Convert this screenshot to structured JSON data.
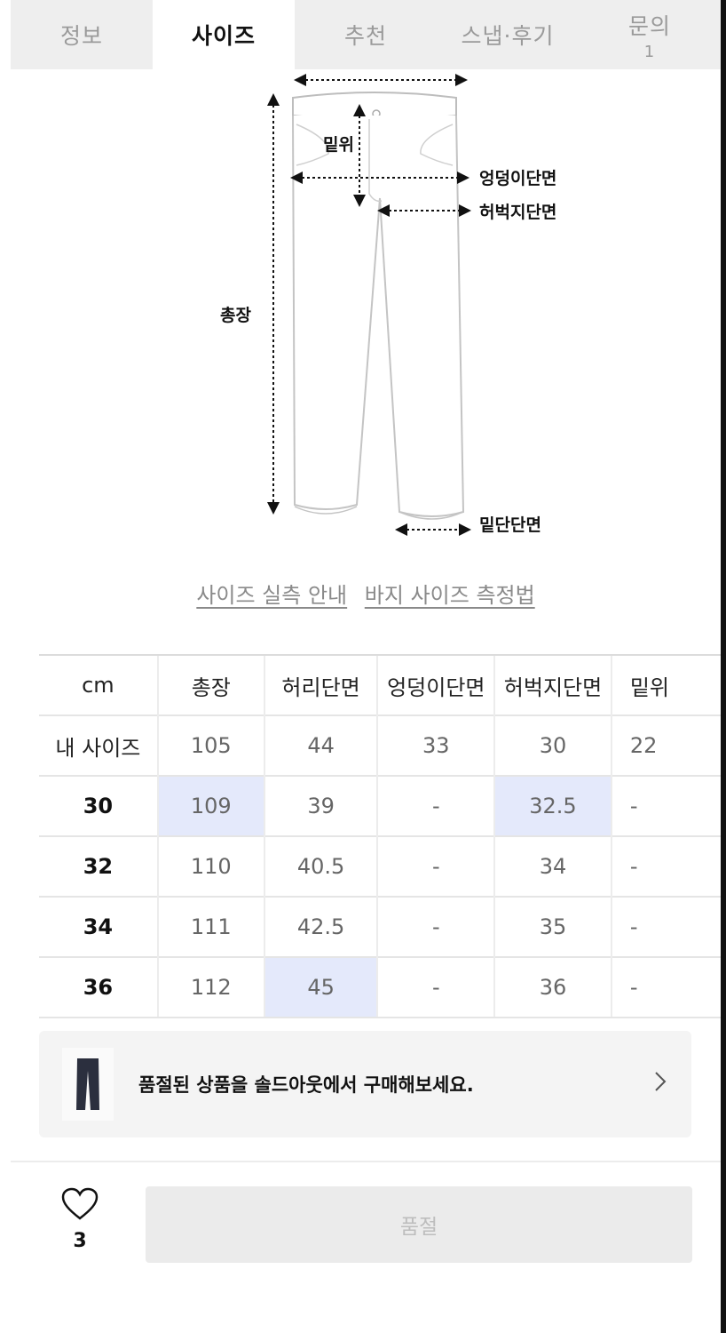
{
  "tabs": [
    {
      "label": "정보",
      "count": ""
    },
    {
      "label": "사이즈",
      "count": ""
    },
    {
      "label": "추천",
      "count": ""
    },
    {
      "label": "스냅·후기",
      "count": ""
    },
    {
      "label": "문의",
      "count": "1"
    }
  ],
  "diagram": {
    "labels": {
      "rise": "밑위",
      "hip": "엉덩이단면",
      "thigh": "허벅지단면",
      "length": "총장",
      "hem": "밑단단면"
    }
  },
  "links": {
    "size_guide": "사이즈 실측 안내",
    "measure_method": "바지 사이즈 측정법"
  },
  "size_table": {
    "unit": "cm",
    "headers": [
      "총장",
      "허리단면",
      "엉덩이단면",
      "허벅지단면",
      "밑위"
    ],
    "my_size": {
      "label": "내 사이즈",
      "values": [
        "105",
        "44",
        "33",
        "30",
        "22"
      ]
    },
    "rows": [
      {
        "size": "30",
        "values": [
          "109",
          "39",
          "-",
          "32.5",
          "-"
        ]
      },
      {
        "size": "32",
        "values": [
          "110",
          "40.5",
          "-",
          "34",
          "-"
        ]
      },
      {
        "size": "34",
        "values": [
          "111",
          "42.5",
          "-",
          "35",
          "-"
        ]
      },
      {
        "size": "36",
        "values": [
          "112",
          "45",
          "-",
          "36",
          "-"
        ]
      }
    ],
    "highlight_color": "#e4e9fb"
  },
  "banner": {
    "text": "품절된 상품을 솔드아웃에서 구매해보세요.",
    "thumb_icon": "pants-icon",
    "chevron_icon": "chevron-right-icon"
  },
  "bottom_bar": {
    "like_icon": "heart-icon",
    "like_count": "3",
    "buy_label": "품절"
  }
}
